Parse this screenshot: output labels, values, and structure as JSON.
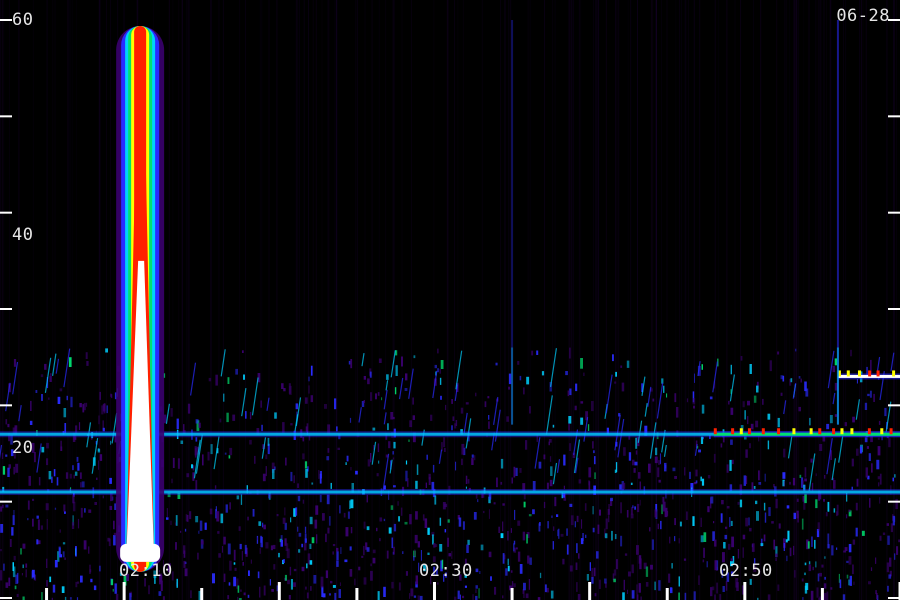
{
  "chart_data": {
    "type": "heatmap",
    "title": "",
    "date_label": "06-28",
    "xlabel": "",
    "ylabel": "",
    "xlim": [
      "02:02",
      "03:00"
    ],
    "ylim": [
      0,
      60
    ],
    "x_tick_labels": [
      "02:10",
      "02:30",
      "02:50"
    ],
    "x_minor_tick_interval_minutes": 5,
    "y_tick_labels": [
      "60",
      "40",
      "20"
    ],
    "y_minor_tick_interval": 10,
    "colormap": [
      "#000000",
      "#3a006e",
      "#2a2bff",
      "#00d0ff",
      "#00e070",
      "#ffff00",
      "#ff2000",
      "#ffffff"
    ],
    "background": "#000000",
    "features": [
      {
        "kind": "burst",
        "time": "02:10",
        "y_from": 5,
        "y_to": 60,
        "intensity": "max"
      },
      {
        "kind": "band",
        "time_from": "02:02",
        "time_to": "03:00",
        "y": 17,
        "intensity": "medium"
      },
      {
        "kind": "band",
        "time_from": "02:48",
        "time_to": "03:00",
        "y": 17,
        "intensity": "high"
      },
      {
        "kind": "band",
        "time_from": "02:56",
        "time_to": "03:00",
        "y": 23,
        "intensity": "max"
      },
      {
        "kind": "band",
        "time_from": "02:02",
        "time_to": "03:00",
        "y": 11,
        "intensity": "medium"
      },
      {
        "kind": "spike",
        "time": "02:56",
        "y_from": 18,
        "y_to": 60,
        "intensity": "low"
      },
      {
        "kind": "spike",
        "time": "02:35",
        "y_from": 18,
        "y_to": 60,
        "intensity": "faint"
      }
    ]
  }
}
